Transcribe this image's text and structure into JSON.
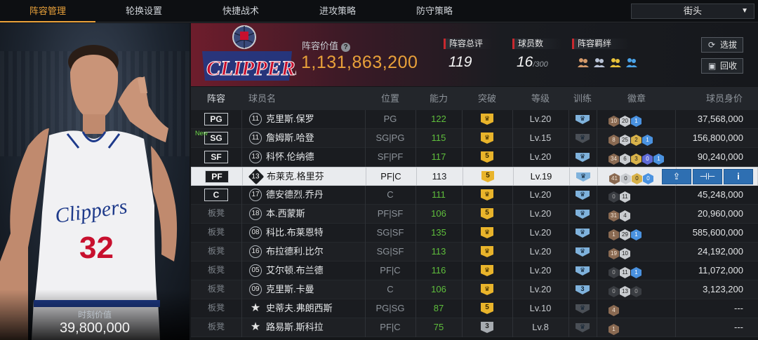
{
  "nav": {
    "tabs": [
      "阵容管理",
      "轮换设置",
      "快捷战术",
      "进攻策略",
      "防守策略"
    ],
    "mode_select": "街头"
  },
  "player_panel": {
    "name_in_image": "Clippers",
    "jersey_number": "32",
    "moment_value_label": "时刻价值",
    "moment_value": "39,800,000"
  },
  "team": {
    "logo_text": "CLIPPERS",
    "value_label": "阵容价值",
    "value": "1,131,863,200",
    "rating_label": "阵容总评",
    "rating": "119",
    "player_count_label": "球员数",
    "player_count": "16",
    "player_count_max": "/300",
    "chemistry_label": "阵容羁绊",
    "chemistry_icons": [
      "chemistry-icon-1",
      "chemistry-icon-2",
      "chemistry-icon-3",
      "chemistry-icon-4"
    ],
    "btn_select": "选拔",
    "btn_recycle": "回收"
  },
  "table": {
    "headers": [
      "阵容",
      "球员名",
      "位置",
      "能力",
      "突破",
      "等级",
      "训练",
      "徽章",
      "球员身价"
    ],
    "rows": [
      {
        "slot": "PG",
        "is_new": false,
        "jersey": "11",
        "name": "克里斯.保罗",
        "position": "PG",
        "ability": "122",
        "breakthrough": "",
        "breakthrough_grey": false,
        "level": "Lv.20",
        "training": "",
        "training_dark": false,
        "badges": [
          [
            "b1",
            "10"
          ],
          [
            "b2",
            "20"
          ],
          [
            "b5",
            "1"
          ]
        ],
        "value": "37,568,000"
      },
      {
        "slot": "SG",
        "is_new": true,
        "new_label": "New",
        "jersey": "11",
        "name": "詹姆斯.哈登",
        "position": "SG|PG",
        "ability": "115",
        "breakthrough": "",
        "breakthrough_grey": false,
        "level": "Lv.15",
        "training": "",
        "training_dark": true,
        "badges": [
          [
            "b1",
            "8"
          ],
          [
            "b2",
            "25"
          ],
          [
            "b3",
            "2"
          ],
          [
            "b5",
            "1"
          ]
        ],
        "value": "156,800,000"
      },
      {
        "slot": "SF",
        "is_new": false,
        "jersey": "13",
        "name": "科怀.伦纳德",
        "position": "SF|PF",
        "ability": "117",
        "breakthrough": "5",
        "breakthrough_grey": false,
        "level": "Lv.20",
        "training": "",
        "training_dark": false,
        "badges": [
          [
            "b1",
            "34"
          ],
          [
            "b2",
            "6"
          ],
          [
            "b3",
            "3"
          ],
          [
            "b4",
            "0"
          ],
          [
            "b5",
            "1"
          ]
        ],
        "value": "90,240,000"
      },
      {
        "slot": "PF",
        "is_new": false,
        "jersey": "13",
        "name": "布莱克.格里芬",
        "position": "PF|C",
        "ability": "113",
        "breakthrough": "5",
        "breakthrough_grey": false,
        "level": "Lv.19",
        "training": "",
        "training_dark": false,
        "badges": [
          [
            "b1",
            "41"
          ],
          [
            "b2",
            "0"
          ],
          [
            "b3",
            "0"
          ],
          [
            "b5",
            "0"
          ]
        ],
        "value": "",
        "selected": true
      },
      {
        "slot": "C",
        "is_new": false,
        "jersey": "17",
        "name": "德安德烈.乔丹",
        "position": "C",
        "ability": "111",
        "breakthrough": "",
        "breakthrough_grey": false,
        "level": "Lv.20",
        "training": "",
        "training_dark": false,
        "badges": [
          [
            "b0",
            "0"
          ],
          [
            "b2",
            "11"
          ]
        ],
        "value": "45,248,000"
      },
      {
        "slot": "板凳",
        "bench": true,
        "is_new": false,
        "jersey": "18",
        "name": "本.西蒙斯",
        "position": "PF|SF",
        "ability": "106",
        "breakthrough": "5",
        "breakthrough_grey": false,
        "level": "Lv.20",
        "training": "",
        "training_dark": false,
        "badges": [
          [
            "b1",
            "31"
          ],
          [
            "b2",
            "4"
          ]
        ],
        "value": "20,960,000"
      },
      {
        "slot": "板凳",
        "bench": true,
        "is_new": false,
        "jersey": "08",
        "name": "科比.布莱恩特",
        "position": "SG|SF",
        "ability": "135",
        "breakthrough": "",
        "breakthrough_grey": false,
        "level": "Lv.20",
        "training": "",
        "training_dark": false,
        "badges": [
          [
            "b1",
            "1"
          ],
          [
            "b2",
            "29"
          ],
          [
            "b5",
            "1"
          ]
        ],
        "value": "585,600,000"
      },
      {
        "slot": "板凳",
        "bench": true,
        "is_new": false,
        "jersey": "16",
        "name": "布拉德利.比尔",
        "position": "SG|SF",
        "ability": "113",
        "breakthrough": "",
        "breakthrough_grey": false,
        "level": "Lv.20",
        "training": "",
        "training_dark": false,
        "badges": [
          [
            "b1",
            "19"
          ],
          [
            "b2",
            "10"
          ]
        ],
        "value": "24,192,000"
      },
      {
        "slot": "板凳",
        "bench": true,
        "is_new": false,
        "jersey": "05",
        "name": "艾尔顿.布兰德",
        "position": "PF|C",
        "ability": "116",
        "breakthrough": "",
        "breakthrough_grey": false,
        "level": "Lv.20",
        "training": "",
        "training_dark": false,
        "badges": [
          [
            "b0",
            "0"
          ],
          [
            "b2",
            "11"
          ],
          [
            "b5",
            "1"
          ]
        ],
        "value": "11,072,000"
      },
      {
        "slot": "板凳",
        "bench": true,
        "is_new": false,
        "jersey": "09",
        "name": "克里斯.卡曼",
        "position": "C",
        "ability": "106",
        "breakthrough": "",
        "breakthrough_grey": false,
        "level": "Lv.20",
        "training": "3",
        "training_dark": false,
        "badges": [
          [
            "b0",
            "0"
          ],
          [
            "b2",
            "13"
          ],
          [
            "b0",
            "0"
          ]
        ],
        "value": "3,123,200"
      },
      {
        "slot": "板凳",
        "bench": true,
        "is_new": false,
        "star": true,
        "jersey": "★",
        "name": "史蒂夫.弗朗西斯",
        "position": "PG|SG",
        "ability": "87",
        "breakthrough": "5",
        "breakthrough_grey": false,
        "level": "Lv.10",
        "training": "",
        "training_dark": true,
        "badges": [
          [
            "b1",
            "4"
          ]
        ],
        "value": "---"
      },
      {
        "slot": "板凳",
        "bench": true,
        "is_new": false,
        "star": true,
        "jersey": "★",
        "name": "路易斯.斯科拉",
        "position": "PF|C",
        "ability": "75",
        "breakthrough": "3",
        "breakthrough_grey": true,
        "level": "Lv.8",
        "training": "",
        "training_dark": true,
        "badges": [
          [
            "b1",
            "1"
          ]
        ],
        "value": "---"
      }
    ],
    "selected_actions": [
      "transfer-icon",
      "train-icon",
      "info-icon"
    ],
    "info_label": "i"
  }
}
